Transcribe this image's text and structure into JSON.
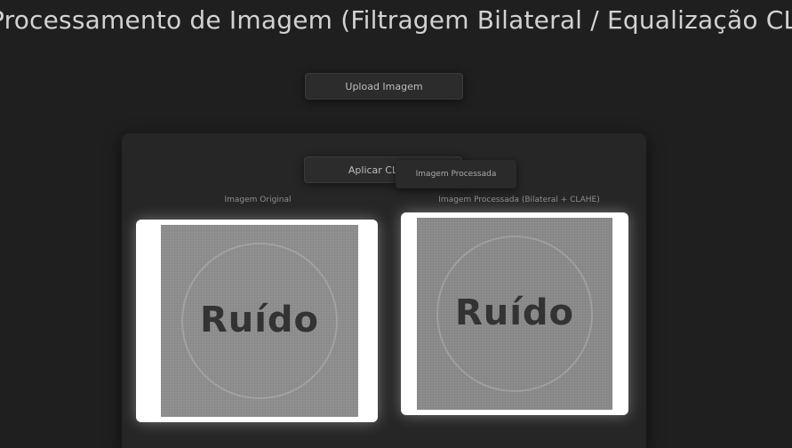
{
  "page": {
    "title": "Processamento de Imagem (Filtragem Bilateral / Equalização CLAHE)"
  },
  "upload": {
    "button_label": "Upload Imagem"
  },
  "processing": {
    "apply_label": "Aplicar CLAHE",
    "original": {
      "label": "Imagem Original",
      "image_text": "Ruído"
    },
    "processed": {
      "label": "Imagem Processada (Bilateral + CLAHE)",
      "image_text": "Ruído",
      "tooltip": "Imagem Processada"
    }
  }
}
